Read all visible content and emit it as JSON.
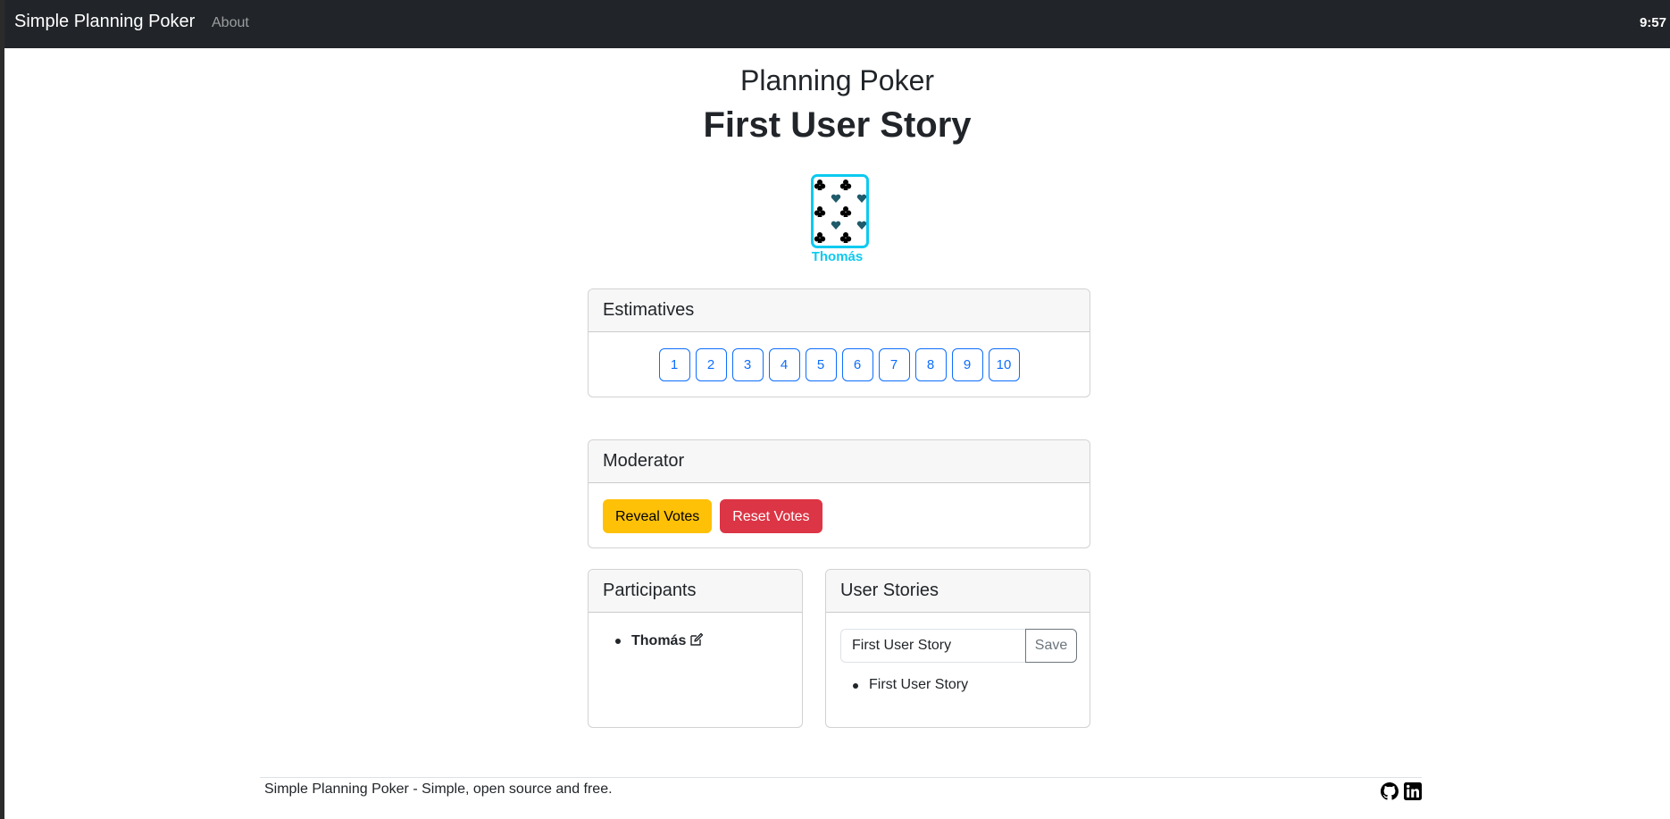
{
  "navbar": {
    "brand": "Simple Planning Poker",
    "about": "About",
    "clock": "9:57"
  },
  "page": {
    "title": "Planning Poker",
    "current_story": "First User Story"
  },
  "player_card": {
    "name": "Thomás",
    "border_color": "#0dcaf0",
    "pattern": "clubs-and-hearts"
  },
  "estimatives": {
    "header": "Estimatives",
    "options": [
      "1",
      "2",
      "3",
      "4",
      "5",
      "6",
      "7",
      "8",
      "9",
      "10"
    ]
  },
  "moderator": {
    "header": "Moderator",
    "reveal_label": "Reveal Votes",
    "reset_label": "Reset Votes"
  },
  "participants": {
    "header": "Participants",
    "items": [
      {
        "name": "Thomás",
        "icon": "edit-icon"
      }
    ]
  },
  "user_stories": {
    "header": "User Stories",
    "input_value": "First User Story",
    "save_label": "Save",
    "items": [
      "First User Story"
    ]
  },
  "footer": {
    "text": "Simple Planning Poker - Simple, open source and free.",
    "icons": [
      "github-icon",
      "linkedin-icon"
    ]
  },
  "colors": {
    "navbar_bg": "#212529",
    "primary": "#0d6efd",
    "warning": "#ffc107",
    "danger": "#dc3545",
    "info": "#0dcaf0"
  }
}
